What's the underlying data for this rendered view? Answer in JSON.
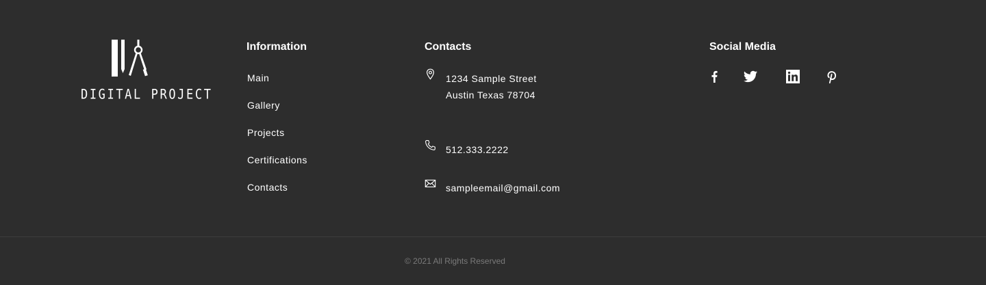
{
  "brand": {
    "logo_text": "DIGITAL PROJECT",
    "logo_icon": "pencils-and-compass-logo"
  },
  "information": {
    "heading": "Information",
    "links": [
      "Main",
      "Gallery",
      "Projects",
      "Certifications",
      "Contacts"
    ]
  },
  "contacts": {
    "heading": "Contacts",
    "address_line1": "1234 Sample Street",
    "address_line2": "Austin Texas 78704",
    "phone": "512.333.2222",
    "email": "sampleemail@gmail.com",
    "icons": [
      "map-pin-icon",
      "phone-icon",
      "envelope-icon"
    ]
  },
  "social": {
    "heading": "Social Media",
    "networks": [
      "facebook-icon",
      "twitter-icon",
      "linkedin-icon",
      "pinterest-icon"
    ]
  },
  "footer": {
    "copyright": "© 2021 All Rights Reserved"
  },
  "colors": {
    "background": "#2d2d2d",
    "text": "#ffffff",
    "muted": "#7a7a7a",
    "divider": "#3d3d3d"
  }
}
